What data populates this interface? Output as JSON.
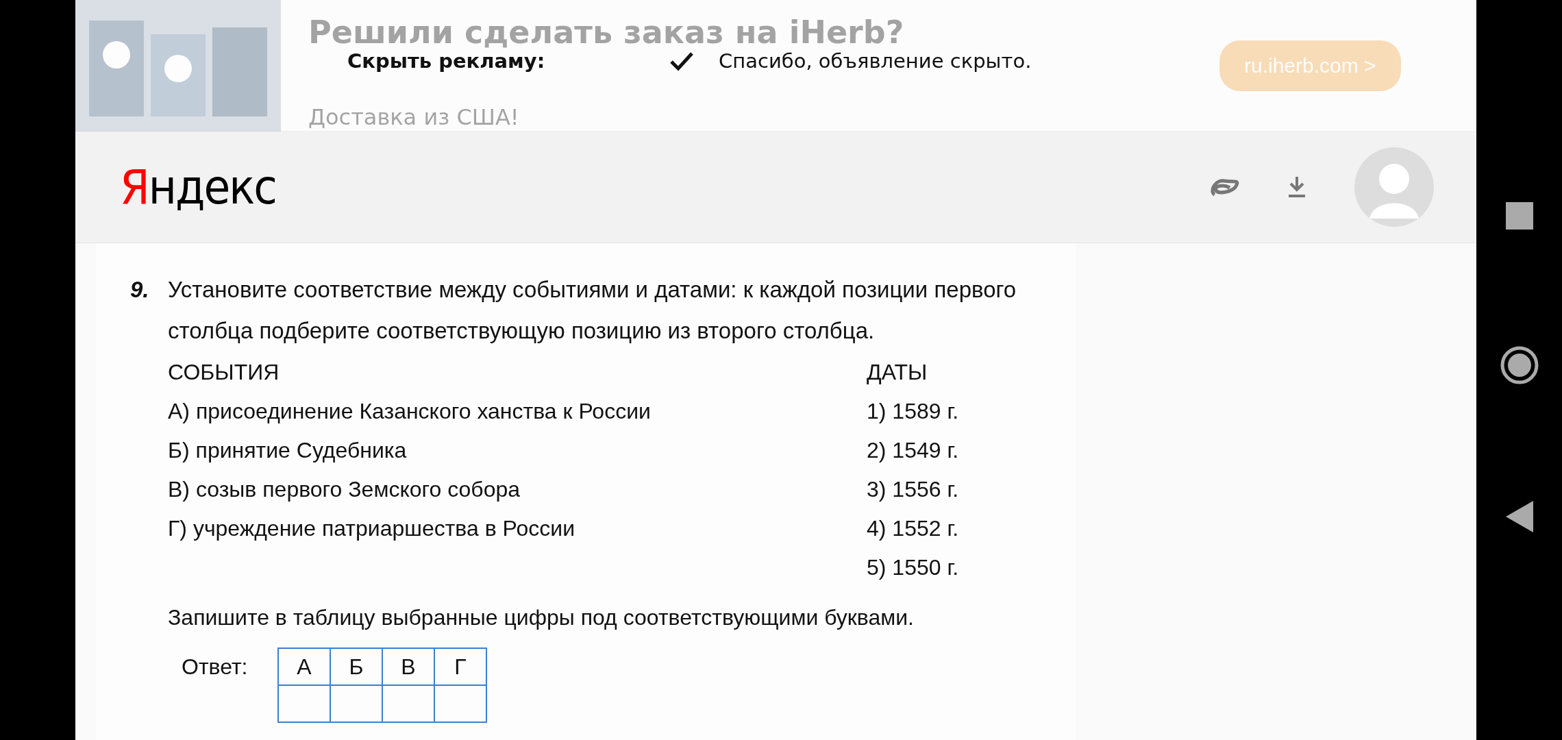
{
  "ad": {
    "title": "Решили сделать заказ на iHerb?",
    "text": "Доставка из США!",
    "link": "ru.iherb.com >",
    "hide_label": "Скрыть рекламу:",
    "hidden_message": "Спасибо, объявление скрыто."
  },
  "header": {
    "logo_first": "Я",
    "logo_rest": "ндекс"
  },
  "question": {
    "number": "9.",
    "text": "Установите соответствие между событиями и датами: к каждой позиции первого столбца подберите соответствующую позицию из второго столбца.",
    "events_heading": "СОБЫТИЯ",
    "dates_heading": "ДАТЫ",
    "events": [
      "А) присоединение Казанского ханства к России",
      "Б) принятие Судебника",
      "В) созыв первого Земского собора",
      "Г) учреждение патриаршества в России"
    ],
    "dates": [
      "1) 1589 г.",
      "2) 1549 г.",
      "3) 1556 г.",
      "4) 1552 г.",
      "5) 1550 г."
    ],
    "instruction": "Запишите в таблицу выбранные цифры под соответствующими буквами.",
    "answer_label": "Ответ:",
    "answer_columns": [
      "А",
      "Б",
      "В",
      "Г"
    ]
  }
}
